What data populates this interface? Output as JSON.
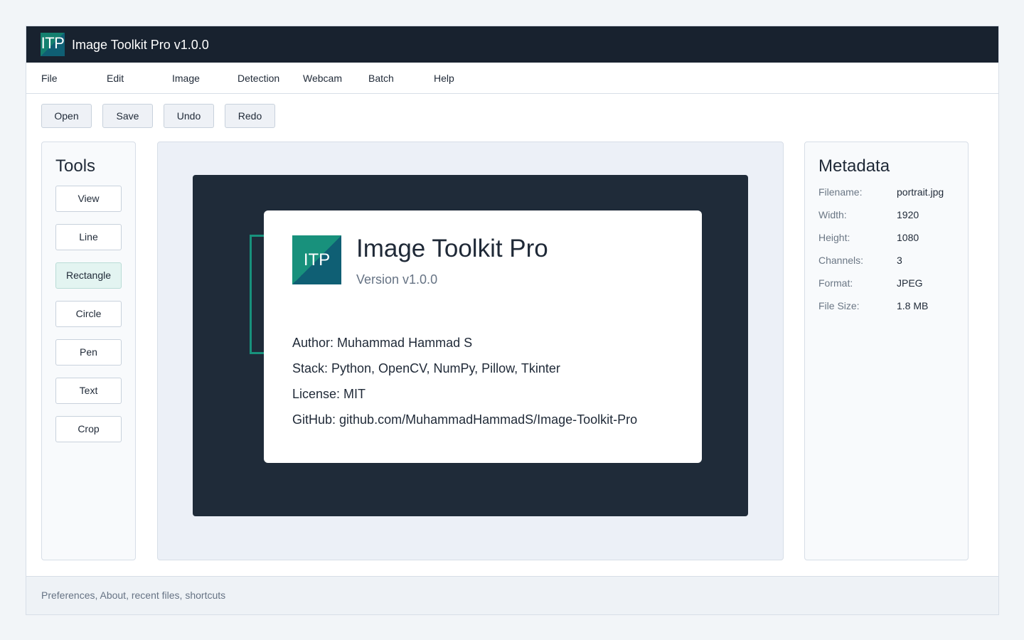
{
  "window": {
    "title": "Image Toolkit Pro v1.0.0",
    "logo_text": "ITP"
  },
  "menu": [
    "File",
    "Edit",
    "Image",
    "Detection",
    "Webcam",
    "Batch",
    "Help"
  ],
  "toolbar": {
    "open": "Open",
    "save": "Save",
    "undo": "Undo",
    "redo": "Redo"
  },
  "tools": {
    "title": "Tools",
    "items": [
      "View",
      "Line",
      "Rectangle",
      "Circle",
      "Pen",
      "Text",
      "Crop"
    ],
    "active": "Rectangle"
  },
  "about": {
    "logo_text": "ITP",
    "name": "Image Toolkit Pro",
    "version": "Version v1.0.0",
    "author": "Author: Muhammad Hammad S",
    "stack": "Stack: Python, OpenCV, NumPy, Pillow, Tkinter",
    "license": "License: MIT",
    "github": "GitHub: github.com/MuhammadHammadS/Image-Toolkit-Pro"
  },
  "metadata": {
    "title": "Metadata",
    "rows": [
      {
        "label": "Filename:",
        "value": "portrait.jpg"
      },
      {
        "label": "Width:",
        "value": "1920"
      },
      {
        "label": "Height:",
        "value": "1080"
      },
      {
        "label": "Channels:",
        "value": "3"
      },
      {
        "label": "Format:",
        "value": "JPEG"
      },
      {
        "label": "File Size:",
        "value": "1.8 MB"
      }
    ]
  },
  "status": {
    "text": "Preferences, About, recent files, shortcuts"
  },
  "colors": {
    "titlebar": "#18222f",
    "accent": "#18917c",
    "accent_dark": "#0f5f74",
    "active_tool": "#e3f4f1"
  }
}
